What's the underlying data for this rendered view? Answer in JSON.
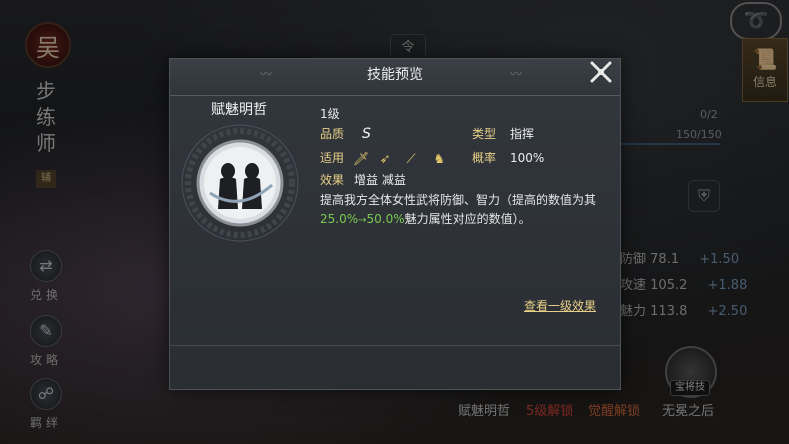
{
  "background": {
    "faction_badge": "吴",
    "class_title": "步练师",
    "aux_tag": "辅",
    "side_buttons": [
      {
        "label": "兑换",
        "icon": "exchange-icon"
      },
      {
        "label": "攻略",
        "icon": "guide-icon"
      },
      {
        "label": "羁绊",
        "icon": "bond-icon"
      }
    ],
    "info_tab_label": "信息",
    "order_tab": "令",
    "right_panel": {
      "count": "0/2",
      "progress": "150/150"
    },
    "stats": [
      {
        "name": "防御",
        "value": "78.1",
        "gain": "+1.50"
      },
      {
        "name": "攻速",
        "value": "105.2",
        "gain": "+1.88"
      },
      {
        "name": "魅力",
        "value": "113.8",
        "gain": "+2.50"
      }
    ],
    "bottom_skills": [
      {
        "label": "赋魅明哲",
        "color": "#c9c9c9"
      },
      {
        "label": "5级解锁",
        "color": "#d9453a"
      },
      {
        "label": "觉醒解锁",
        "color": "#d96a3a"
      },
      {
        "label": "无冕之后",
        "color": "#c9c9c9"
      }
    ],
    "emperor_tag": "宝将技"
  },
  "modal": {
    "title": "技能预览",
    "skill_name": "赋魅明哲",
    "level": "1级",
    "quality_label": "品质",
    "quality_value": "S",
    "type_label": "类型",
    "type_value": "指挥",
    "applicable_label": "适用",
    "applicable_weapons": [
      "sword-icon",
      "bow-icon",
      "spear-icon",
      "horse-icon"
    ],
    "rate_label": "概率",
    "rate_value": "100%",
    "effect_label": "效果",
    "effect_values": "增益 减益",
    "desc_prefix": "提高我方全体女性武将防御、智力（提高的数值为其",
    "desc_value_from": "25.0%",
    "desc_arrow": "→",
    "desc_value_to": "50.0%",
    "desc_suffix": "魅力属性对应的数值）。",
    "view_level1_link": "查看一级效果",
    "colors": {
      "accent_gold": "#e7cf87",
      "accent_green": "#7ac94f"
    }
  }
}
